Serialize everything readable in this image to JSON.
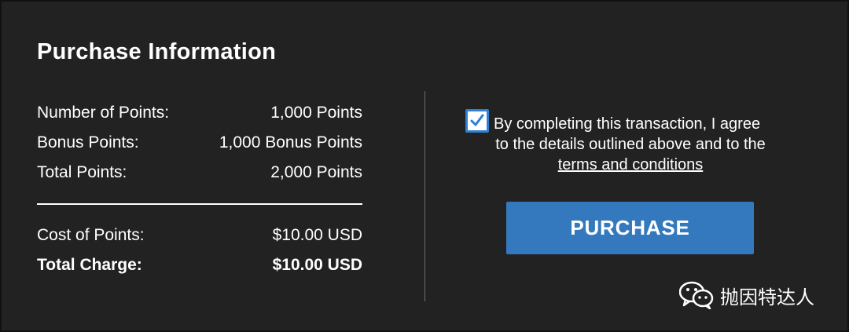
{
  "title": "Purchase Information",
  "summary": {
    "rows": [
      {
        "label": "Number of Points:",
        "value": "1,000 Points"
      },
      {
        "label": "Bonus Points:",
        "value": "1,000 Bonus Points"
      },
      {
        "label": "Total Points:",
        "value": "2,000 Points"
      }
    ],
    "cost": {
      "label": "Cost of Points:",
      "value": "$10.00 USD"
    },
    "total": {
      "label": "Total Charge:",
      "value": "$10.00 USD"
    }
  },
  "agreement": {
    "checked": true,
    "line1": "By completing this transaction, I agree",
    "line2": "to the details outlined above and to the",
    "link": "terms and conditions"
  },
  "purchase_button": "PURCHASE",
  "watermark": {
    "icon": "wechat-icon",
    "text": "抛因特达人"
  },
  "colors": {
    "background": "#222222",
    "button": "#3479bd",
    "checkbox_border": "#2f7fd4"
  }
}
